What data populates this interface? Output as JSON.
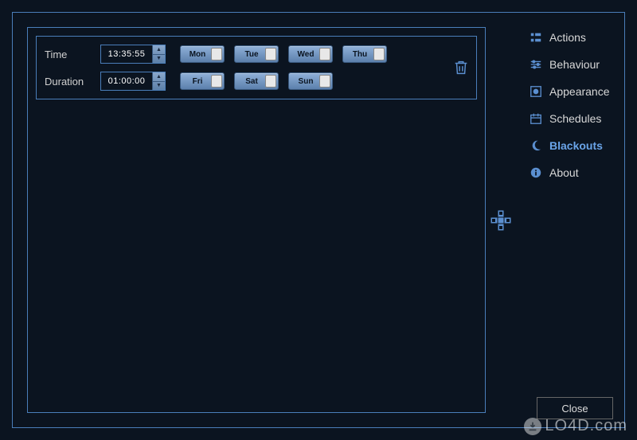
{
  "labels": {
    "time": "Time",
    "duration": "Duration"
  },
  "entry": {
    "time_value": "13:35:55",
    "duration_value": "01:00:00",
    "days_row1": [
      "Mon",
      "Tue",
      "Wed",
      "Thu"
    ],
    "days_row2": [
      "Fri",
      "Sat",
      "Sun"
    ]
  },
  "sidebar": {
    "items": [
      {
        "label": "Actions",
        "icon": "actions-icon",
        "active": false
      },
      {
        "label": "Behaviour",
        "icon": "behaviour-icon",
        "active": false
      },
      {
        "label": "Appearance",
        "icon": "appearance-icon",
        "active": false
      },
      {
        "label": "Schedules",
        "icon": "schedules-icon",
        "active": false
      },
      {
        "label": "Blackouts",
        "icon": "blackouts-icon",
        "active": true
      },
      {
        "label": "About",
        "icon": "about-icon",
        "active": false
      }
    ]
  },
  "buttons": {
    "close": "Close"
  },
  "watermark": "LO4D.com",
  "colors": {
    "accent": "#4a7eba",
    "bg": "#0b1420"
  }
}
